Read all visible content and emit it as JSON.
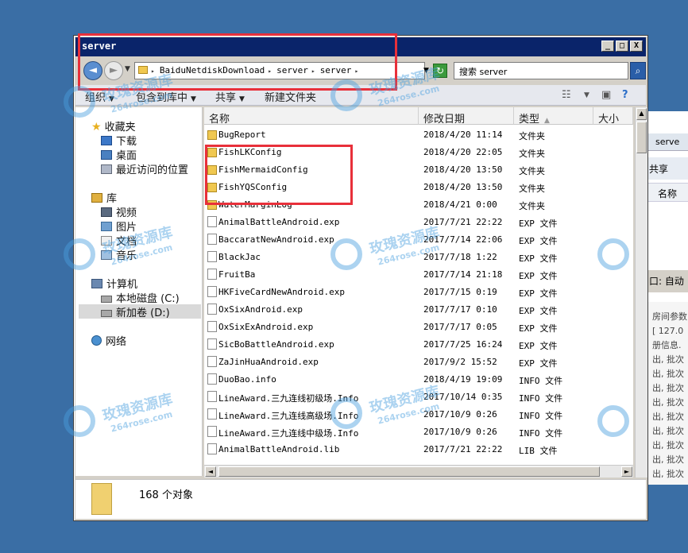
{
  "window": {
    "title": "server",
    "minimize": "_",
    "maximize": "□",
    "close": "X"
  },
  "address": {
    "back": "◄",
    "forward": "►",
    "segments": [
      "BaiduNetdiskDownload",
      "server",
      "server"
    ],
    "search_placeholder": "搜索 server",
    "search_icon": "search-icon"
  },
  "toolbar": {
    "organize": "组织",
    "include_in_library": "包含到库中",
    "share": "共享",
    "new_folder": "新建文件夹"
  },
  "nav": {
    "favorites": "收藏夹",
    "downloads": "下载",
    "desktop": "桌面",
    "recent": "最近访问的位置",
    "libraries": "库",
    "videos": "视频",
    "pictures": "图片",
    "documents": "文档",
    "music": "音乐",
    "computer": "计算机",
    "local_disk_c": "本地磁盘 (C:)",
    "new_volume_d": "新加卷 (D:)",
    "network": "网络"
  },
  "columns": {
    "name": "名称",
    "modified": "修改日期",
    "type": "类型",
    "size": "大小"
  },
  "files": [
    {
      "name": "BugReport",
      "date": "2018/4/20 11:14",
      "type": "文件夹",
      "kind": "folder"
    },
    {
      "name": "FishLKConfig",
      "date": "2018/4/20 22:05",
      "type": "文件夹",
      "kind": "folder"
    },
    {
      "name": "FishMermaidConfig",
      "date": "2018/4/20 13:50",
      "type": "文件夹",
      "kind": "folder"
    },
    {
      "name": "FishYQSConfig",
      "date": "2018/4/20 13:50",
      "type": "文件夹",
      "kind": "folder"
    },
    {
      "name": "WaterMarginLog",
      "date": "2018/4/21 0:00",
      "type": "文件夹",
      "kind": "folder"
    },
    {
      "name": "AnimalBattleAndroid.exp",
      "date": "2017/7/21 22:22",
      "type": "EXP 文件",
      "kind": "file"
    },
    {
      "name": "BaccaratNewAndroid.exp",
      "date": "2017/7/14 22:06",
      "type": "EXP 文件",
      "kind": "file"
    },
    {
      "name": "BlackJac",
      "date": "2017/7/18 1:22",
      "type": "EXP 文件",
      "kind": "file"
    },
    {
      "name": "FruitBa",
      "date": "2017/7/14 21:18",
      "type": "EXP 文件",
      "kind": "file"
    },
    {
      "name": "HKFiveCardNewAndroid.exp",
      "date": "2017/7/15 0:19",
      "type": "EXP 文件",
      "kind": "file"
    },
    {
      "name": "OxSixAndroid.exp",
      "date": "2017/7/17 0:10",
      "type": "EXP 文件",
      "kind": "file"
    },
    {
      "name": "OxSixExAndroid.exp",
      "date": "2017/7/17 0:05",
      "type": "EXP 文件",
      "kind": "file"
    },
    {
      "name": "SicBoBattleAndroid.exp",
      "date": "2017/7/25 16:24",
      "type": "EXP 文件",
      "kind": "file"
    },
    {
      "name": "ZaJinHuaAndroid.exp",
      "date": "2017/9/2 15:52",
      "type": "EXP 文件",
      "kind": "file"
    },
    {
      "name": "DuoBao.info",
      "date": "2018/4/19 19:09",
      "type": "INFO 文件",
      "kind": "file"
    },
    {
      "name": "LineAward.三九连线初级场.Info",
      "date": "2017/10/14 0:35",
      "type": "INFO 文件",
      "kind": "file"
    },
    {
      "name": "LineAward.三九连线高级场.Info",
      "date": "2017/10/9 0:26",
      "type": "INFO 文件",
      "kind": "file"
    },
    {
      "name": "LineAward.三九连线中级场.Info",
      "date": "2017/10/9 0:26",
      "type": "INFO 文件",
      "kind": "file"
    },
    {
      "name": "AnimalBattleAndroid.lib",
      "date": "2017/7/21 22:22",
      "type": "LIB 文件",
      "kind": "file"
    }
  ],
  "status": {
    "count": "168 个对象"
  },
  "background_window": {
    "tab": "serve",
    "share": "共享",
    "name_col": "名称",
    "input_label": "口:",
    "auto_label": "自动",
    "log_text": "房间参数",
    "log_lines": [
      "[ 127.0",
      "册信息.",
      "出, 批次",
      "出, 批次",
      "出, 批次",
      "出, 批次",
      "出, 批次",
      "出, 批次",
      "出, 批次",
      "出, 批次",
      "出, 批次"
    ]
  },
  "watermark": {
    "cn": "玫瑰资源库",
    "en": "264rose.com"
  }
}
